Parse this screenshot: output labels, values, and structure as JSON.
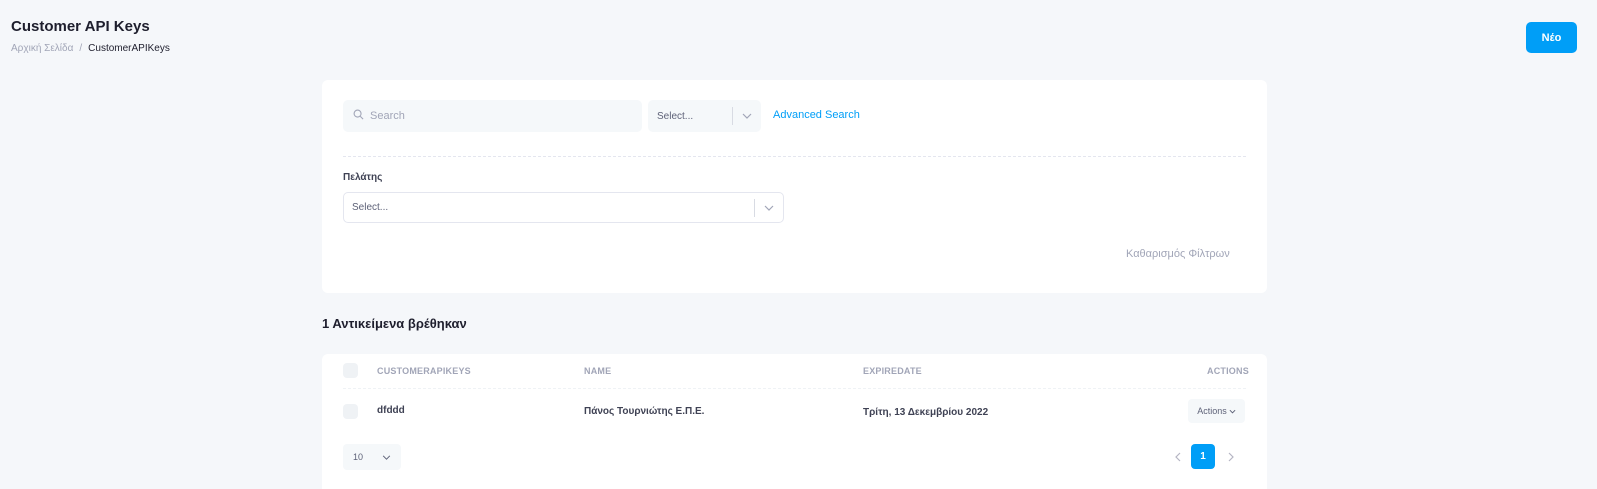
{
  "header": {
    "title": "Customer API Keys",
    "breadcrumb": {
      "home": "Αρχική Σελίδα",
      "separator": "/",
      "current": "CustomerAPIKeys"
    },
    "new_button": "Νέο"
  },
  "filters": {
    "search_placeholder": "Search",
    "select_placeholder": "Select...",
    "advanced_search": "Advanced Search",
    "customer_label": "Πελάτης",
    "customer_select_placeholder": "Select...",
    "clear_filters": "Καθαρισμός Φίλτρων"
  },
  "results": {
    "count_text": "1 Αντικείμενα βρέθηκαν"
  },
  "table": {
    "columns": [
      "CUSTOMERAPIKEYS",
      "NAME",
      "EXPIREDATE",
      "ACTIONS"
    ],
    "rows": [
      {
        "key": "dfddd",
        "name": "Πάνος Τουρνιώτης Ε.Π.Ε.",
        "expire_date": "Τρίτη, 13 Δεκεμβρίου 2022",
        "actions_label": "Actions"
      }
    ]
  },
  "pagination": {
    "per_page": "10",
    "current_page": "1"
  },
  "colors": {
    "accent": "#009ef7",
    "background": "#f5f7fa",
    "muted": "#a1a5b7"
  }
}
